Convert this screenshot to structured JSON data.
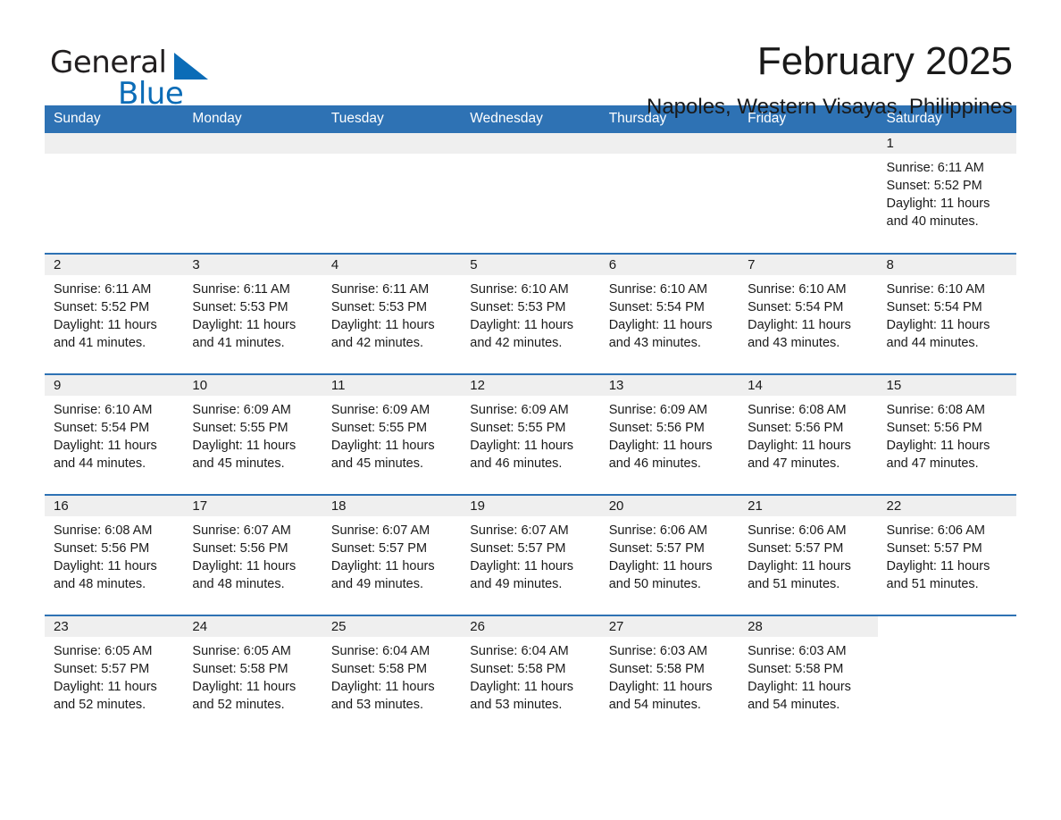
{
  "brand": {
    "name_part1": "General",
    "name_part2": "Blue",
    "triangle_color": "#0b6cb7"
  },
  "header": {
    "month_title": "February 2025",
    "location": "Napoles, Western Visayas, Philippines"
  },
  "colors": {
    "header_blue": "#2e72b4",
    "date_band_gray": "#efefef",
    "text": "#1a1a1a",
    "brand_blue": "#0b6cb7"
  },
  "weekday_headers": [
    "Sunday",
    "Monday",
    "Tuesday",
    "Wednesday",
    "Thursday",
    "Friday",
    "Saturday"
  ],
  "labels": {
    "sunrise_prefix": "Sunrise:",
    "sunset_prefix": "Sunset:",
    "daylight_prefix": "Daylight:"
  },
  "weeks": [
    [
      {
        "empty": true
      },
      {
        "empty": true
      },
      {
        "empty": true
      },
      {
        "empty": true
      },
      {
        "empty": true
      },
      {
        "empty": true
      },
      {
        "day": "1",
        "sunrise": "Sunrise: 6:11 AM",
        "sunset": "Sunset: 5:52 PM",
        "daylight_line1": "Daylight: 11 hours",
        "daylight_line2": "and 40 minutes."
      }
    ],
    [
      {
        "day": "2",
        "sunrise": "Sunrise: 6:11 AM",
        "sunset": "Sunset: 5:52 PM",
        "daylight_line1": "Daylight: 11 hours",
        "daylight_line2": "and 41 minutes."
      },
      {
        "day": "3",
        "sunrise": "Sunrise: 6:11 AM",
        "sunset": "Sunset: 5:53 PM",
        "daylight_line1": "Daylight: 11 hours",
        "daylight_line2": "and 41 minutes."
      },
      {
        "day": "4",
        "sunrise": "Sunrise: 6:11 AM",
        "sunset": "Sunset: 5:53 PM",
        "daylight_line1": "Daylight: 11 hours",
        "daylight_line2": "and 42 minutes."
      },
      {
        "day": "5",
        "sunrise": "Sunrise: 6:10 AM",
        "sunset": "Sunset: 5:53 PM",
        "daylight_line1": "Daylight: 11 hours",
        "daylight_line2": "and 42 minutes."
      },
      {
        "day": "6",
        "sunrise": "Sunrise: 6:10 AM",
        "sunset": "Sunset: 5:54 PM",
        "daylight_line1": "Daylight: 11 hours",
        "daylight_line2": "and 43 minutes."
      },
      {
        "day": "7",
        "sunrise": "Sunrise: 6:10 AM",
        "sunset": "Sunset: 5:54 PM",
        "daylight_line1": "Daylight: 11 hours",
        "daylight_line2": "and 43 minutes."
      },
      {
        "day": "8",
        "sunrise": "Sunrise: 6:10 AM",
        "sunset": "Sunset: 5:54 PM",
        "daylight_line1": "Daylight: 11 hours",
        "daylight_line2": "and 44 minutes."
      }
    ],
    [
      {
        "day": "9",
        "sunrise": "Sunrise: 6:10 AM",
        "sunset": "Sunset: 5:54 PM",
        "daylight_line1": "Daylight: 11 hours",
        "daylight_line2": "and 44 minutes."
      },
      {
        "day": "10",
        "sunrise": "Sunrise: 6:09 AM",
        "sunset": "Sunset: 5:55 PM",
        "daylight_line1": "Daylight: 11 hours",
        "daylight_line2": "and 45 minutes."
      },
      {
        "day": "11",
        "sunrise": "Sunrise: 6:09 AM",
        "sunset": "Sunset: 5:55 PM",
        "daylight_line1": "Daylight: 11 hours",
        "daylight_line2": "and 45 minutes."
      },
      {
        "day": "12",
        "sunrise": "Sunrise: 6:09 AM",
        "sunset": "Sunset: 5:55 PM",
        "daylight_line1": "Daylight: 11 hours",
        "daylight_line2": "and 46 minutes."
      },
      {
        "day": "13",
        "sunrise": "Sunrise: 6:09 AM",
        "sunset": "Sunset: 5:56 PM",
        "daylight_line1": "Daylight: 11 hours",
        "daylight_line2": "and 46 minutes."
      },
      {
        "day": "14",
        "sunrise": "Sunrise: 6:08 AM",
        "sunset": "Sunset: 5:56 PM",
        "daylight_line1": "Daylight: 11 hours",
        "daylight_line2": "and 47 minutes."
      },
      {
        "day": "15",
        "sunrise": "Sunrise: 6:08 AM",
        "sunset": "Sunset: 5:56 PM",
        "daylight_line1": "Daylight: 11 hours",
        "daylight_line2": "and 47 minutes."
      }
    ],
    [
      {
        "day": "16",
        "sunrise": "Sunrise: 6:08 AM",
        "sunset": "Sunset: 5:56 PM",
        "daylight_line1": "Daylight: 11 hours",
        "daylight_line2": "and 48 minutes."
      },
      {
        "day": "17",
        "sunrise": "Sunrise: 6:07 AM",
        "sunset": "Sunset: 5:56 PM",
        "daylight_line1": "Daylight: 11 hours",
        "daylight_line2": "and 48 minutes."
      },
      {
        "day": "18",
        "sunrise": "Sunrise: 6:07 AM",
        "sunset": "Sunset: 5:57 PM",
        "daylight_line1": "Daylight: 11 hours",
        "daylight_line2": "and 49 minutes."
      },
      {
        "day": "19",
        "sunrise": "Sunrise: 6:07 AM",
        "sunset": "Sunset: 5:57 PM",
        "daylight_line1": "Daylight: 11 hours",
        "daylight_line2": "and 49 minutes."
      },
      {
        "day": "20",
        "sunrise": "Sunrise: 6:06 AM",
        "sunset": "Sunset: 5:57 PM",
        "daylight_line1": "Daylight: 11 hours",
        "daylight_line2": "and 50 minutes."
      },
      {
        "day": "21",
        "sunrise": "Sunrise: 6:06 AM",
        "sunset": "Sunset: 5:57 PM",
        "daylight_line1": "Daylight: 11 hours",
        "daylight_line2": "and 51 minutes."
      },
      {
        "day": "22",
        "sunrise": "Sunrise: 6:06 AM",
        "sunset": "Sunset: 5:57 PM",
        "daylight_line1": "Daylight: 11 hours",
        "daylight_line2": "and 51 minutes."
      }
    ],
    [
      {
        "day": "23",
        "sunrise": "Sunrise: 6:05 AM",
        "sunset": "Sunset: 5:57 PM",
        "daylight_line1": "Daylight: 11 hours",
        "daylight_line2": "and 52 minutes."
      },
      {
        "day": "24",
        "sunrise": "Sunrise: 6:05 AM",
        "sunset": "Sunset: 5:58 PM",
        "daylight_line1": "Daylight: 11 hours",
        "daylight_line2": "and 52 minutes."
      },
      {
        "day": "25",
        "sunrise": "Sunrise: 6:04 AM",
        "sunset": "Sunset: 5:58 PM",
        "daylight_line1": "Daylight: 11 hours",
        "daylight_line2": "and 53 minutes."
      },
      {
        "day": "26",
        "sunrise": "Sunrise: 6:04 AM",
        "sunset": "Sunset: 5:58 PM",
        "daylight_line1": "Daylight: 11 hours",
        "daylight_line2": "and 53 minutes."
      },
      {
        "day": "27",
        "sunrise": "Sunrise: 6:03 AM",
        "sunset": "Sunset: 5:58 PM",
        "daylight_line1": "Daylight: 11 hours",
        "daylight_line2": "and 54 minutes."
      },
      {
        "day": "28",
        "sunrise": "Sunrise: 6:03 AM",
        "sunset": "Sunset: 5:58 PM",
        "daylight_line1": "Daylight: 11 hours",
        "daylight_line2": "and 54 minutes."
      },
      {
        "empty": true,
        "no_band": true
      }
    ]
  ]
}
